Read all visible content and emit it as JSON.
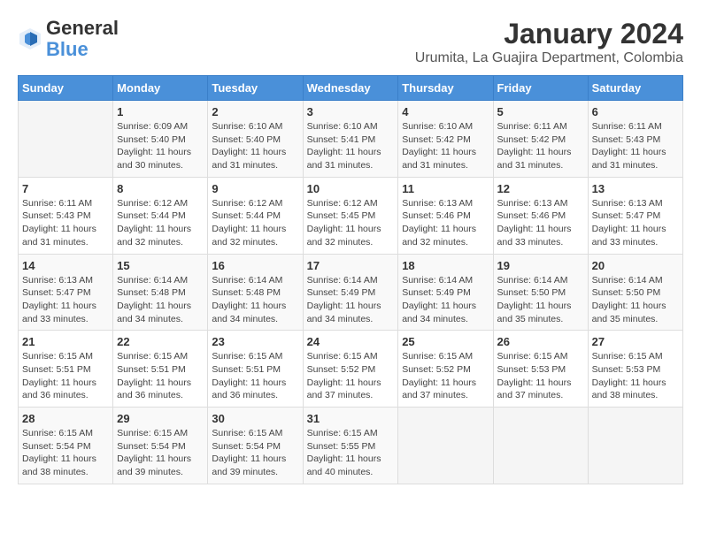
{
  "header": {
    "logo_line1": "General",
    "logo_line2": "Blue",
    "title": "January 2024",
    "subtitle": "Urumita, La Guajira Department, Colombia"
  },
  "days_of_week": [
    "Sunday",
    "Monday",
    "Tuesday",
    "Wednesday",
    "Thursday",
    "Friday",
    "Saturday"
  ],
  "weeks": [
    [
      {
        "day": "",
        "info": ""
      },
      {
        "day": "1",
        "info": "Sunrise: 6:09 AM\nSunset: 5:40 PM\nDaylight: 11 hours\nand 30 minutes."
      },
      {
        "day": "2",
        "info": "Sunrise: 6:10 AM\nSunset: 5:40 PM\nDaylight: 11 hours\nand 31 minutes."
      },
      {
        "day": "3",
        "info": "Sunrise: 6:10 AM\nSunset: 5:41 PM\nDaylight: 11 hours\nand 31 minutes."
      },
      {
        "day": "4",
        "info": "Sunrise: 6:10 AM\nSunset: 5:42 PM\nDaylight: 11 hours\nand 31 minutes."
      },
      {
        "day": "5",
        "info": "Sunrise: 6:11 AM\nSunset: 5:42 PM\nDaylight: 11 hours\nand 31 minutes."
      },
      {
        "day": "6",
        "info": "Sunrise: 6:11 AM\nSunset: 5:43 PM\nDaylight: 11 hours\nand 31 minutes."
      }
    ],
    [
      {
        "day": "7",
        "info": "Sunrise: 6:11 AM\nSunset: 5:43 PM\nDaylight: 11 hours\nand 31 minutes."
      },
      {
        "day": "8",
        "info": "Sunrise: 6:12 AM\nSunset: 5:44 PM\nDaylight: 11 hours\nand 32 minutes."
      },
      {
        "day": "9",
        "info": "Sunrise: 6:12 AM\nSunset: 5:44 PM\nDaylight: 11 hours\nand 32 minutes."
      },
      {
        "day": "10",
        "info": "Sunrise: 6:12 AM\nSunset: 5:45 PM\nDaylight: 11 hours\nand 32 minutes."
      },
      {
        "day": "11",
        "info": "Sunrise: 6:13 AM\nSunset: 5:46 PM\nDaylight: 11 hours\nand 32 minutes."
      },
      {
        "day": "12",
        "info": "Sunrise: 6:13 AM\nSunset: 5:46 PM\nDaylight: 11 hours\nand 33 minutes."
      },
      {
        "day": "13",
        "info": "Sunrise: 6:13 AM\nSunset: 5:47 PM\nDaylight: 11 hours\nand 33 minutes."
      }
    ],
    [
      {
        "day": "14",
        "info": "Sunrise: 6:13 AM\nSunset: 5:47 PM\nDaylight: 11 hours\nand 33 minutes."
      },
      {
        "day": "15",
        "info": "Sunrise: 6:14 AM\nSunset: 5:48 PM\nDaylight: 11 hours\nand 34 minutes."
      },
      {
        "day": "16",
        "info": "Sunrise: 6:14 AM\nSunset: 5:48 PM\nDaylight: 11 hours\nand 34 minutes."
      },
      {
        "day": "17",
        "info": "Sunrise: 6:14 AM\nSunset: 5:49 PM\nDaylight: 11 hours\nand 34 minutes."
      },
      {
        "day": "18",
        "info": "Sunrise: 6:14 AM\nSunset: 5:49 PM\nDaylight: 11 hours\nand 34 minutes."
      },
      {
        "day": "19",
        "info": "Sunrise: 6:14 AM\nSunset: 5:50 PM\nDaylight: 11 hours\nand 35 minutes."
      },
      {
        "day": "20",
        "info": "Sunrise: 6:14 AM\nSunset: 5:50 PM\nDaylight: 11 hours\nand 35 minutes."
      }
    ],
    [
      {
        "day": "21",
        "info": "Sunrise: 6:15 AM\nSunset: 5:51 PM\nDaylight: 11 hours\nand 36 minutes."
      },
      {
        "day": "22",
        "info": "Sunrise: 6:15 AM\nSunset: 5:51 PM\nDaylight: 11 hours\nand 36 minutes."
      },
      {
        "day": "23",
        "info": "Sunrise: 6:15 AM\nSunset: 5:51 PM\nDaylight: 11 hours\nand 36 minutes."
      },
      {
        "day": "24",
        "info": "Sunrise: 6:15 AM\nSunset: 5:52 PM\nDaylight: 11 hours\nand 37 minutes."
      },
      {
        "day": "25",
        "info": "Sunrise: 6:15 AM\nSunset: 5:52 PM\nDaylight: 11 hours\nand 37 minutes."
      },
      {
        "day": "26",
        "info": "Sunrise: 6:15 AM\nSunset: 5:53 PM\nDaylight: 11 hours\nand 37 minutes."
      },
      {
        "day": "27",
        "info": "Sunrise: 6:15 AM\nSunset: 5:53 PM\nDaylight: 11 hours\nand 38 minutes."
      }
    ],
    [
      {
        "day": "28",
        "info": "Sunrise: 6:15 AM\nSunset: 5:54 PM\nDaylight: 11 hours\nand 38 minutes."
      },
      {
        "day": "29",
        "info": "Sunrise: 6:15 AM\nSunset: 5:54 PM\nDaylight: 11 hours\nand 39 minutes."
      },
      {
        "day": "30",
        "info": "Sunrise: 6:15 AM\nSunset: 5:54 PM\nDaylight: 11 hours\nand 39 minutes."
      },
      {
        "day": "31",
        "info": "Sunrise: 6:15 AM\nSunset: 5:55 PM\nDaylight: 11 hours\nand 40 minutes."
      },
      {
        "day": "",
        "info": ""
      },
      {
        "day": "",
        "info": ""
      },
      {
        "day": "",
        "info": ""
      }
    ]
  ]
}
